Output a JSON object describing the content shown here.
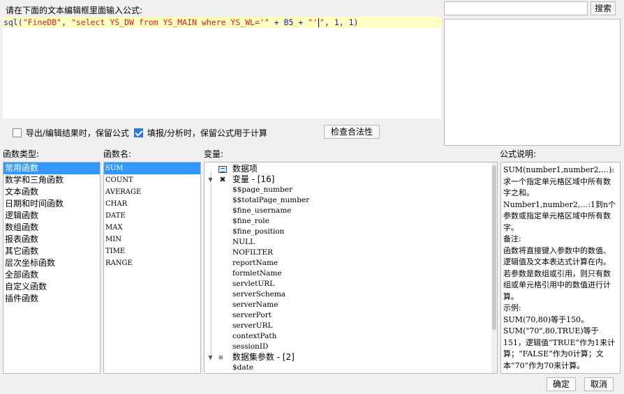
{
  "editor": {
    "prompt": "请在下面的文本编辑框里面输入公式:",
    "formula_before_caret": {
      "func": "sql(",
      "arg1": "\"FineDB\"",
      "sep1": ", ",
      "arg2": "\"select YS_DW from YS_MAIN where YS_WL='\"",
      "op1": " + B5 + ",
      "arg3a": "\"'",
      "arg3b": "\"",
      "tail": ", 1, 1)"
    }
  },
  "search": {
    "value": "",
    "button_label": "搜索"
  },
  "options": {
    "keep_export_label": "导出/编辑结果时，保留公式",
    "keep_export_checked": false,
    "keep_fill_label": "填报/分析时，保留公式用于计算",
    "keep_fill_checked": true,
    "check_button_label": "检查合法性"
  },
  "function_types": {
    "label": "函数类型:",
    "items": [
      "常用函数",
      "数学和三角函数",
      "文本函数",
      "日期和时间函数",
      "逻辑函数",
      "数组函数",
      "报表函数",
      "其它函数",
      "层次坐标函数",
      "全部函数",
      "自定义函数",
      "插件函数"
    ],
    "selected": "常用函数"
  },
  "function_names": {
    "label": "函数名:",
    "items": [
      "SUM",
      "COUNT",
      "AVERAGE",
      "CHAR",
      "DATE",
      "MAX",
      "MIN",
      "TIME",
      "RANGE"
    ],
    "selected": "SUM"
  },
  "variables": {
    "label": "变量:",
    "data_items_node": "数据项",
    "variables_node": "变量 - [16]",
    "variable_items": [
      "$$page_number",
      "$$totalPage_number",
      "$fine_username",
      "$fine_role",
      "$fine_position",
      "NULL",
      "NOFILTER",
      "reportName",
      "formletName",
      "servletURL",
      "serverSchema",
      "serverName",
      "serverPort",
      "serverURL",
      "contextPath",
      "sessionID"
    ],
    "dataset_params_node": "数据集参数 - [2]",
    "dataset_items": [
      "$date"
    ]
  },
  "description": {
    "label": "公式说明:",
    "lines": [
      "SUM(number1,number2,…):求一个指定单元格区域中所有数字之和。",
      "Number1,number2,…:1到n个参数或指定单元格区域中所有数字。",
      "备注:",
      "函数将直接键入参数中的数值、逻辑值及文本表达式计算在内。若参数是数组或引用，则只有数组或单元格引用中的数值进行计算。",
      "示例:",
      "SUM(70,80)等于150。",
      "SUM(\"70\",80,TRUE)等于151，逻辑值“TRUE”作为1来计算；“FALSE”作为0计算；文本“70”作为70来计算。"
    ]
  },
  "footer": {
    "ok_label": "确定",
    "cancel_label": "取消"
  },
  "colors": {
    "selection": "#3399ff",
    "editor_line": "#ffffc2",
    "keyword": "#1a1ab4",
    "string": "#d21e1e"
  }
}
